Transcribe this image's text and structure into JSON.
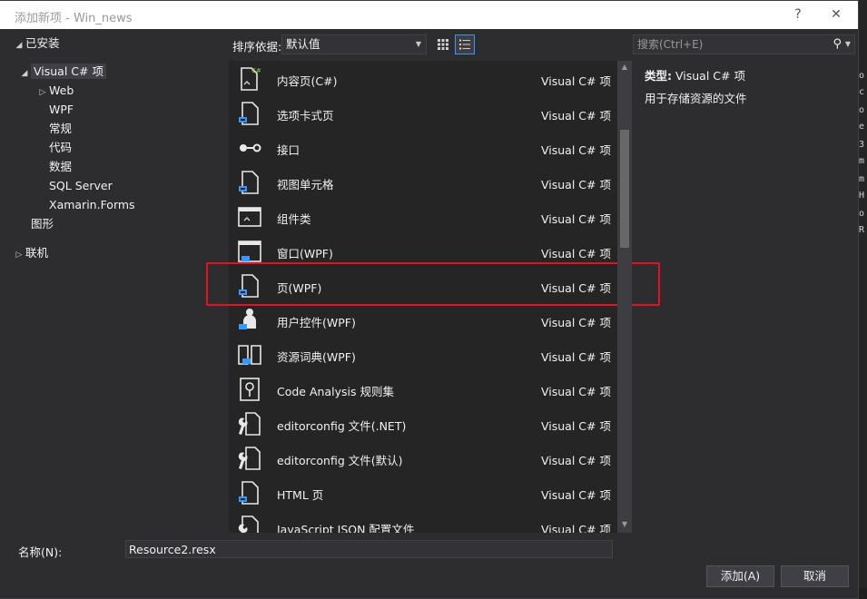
{
  "window": {
    "title": "添加新项 - Win_news",
    "help": "?",
    "close": "✕"
  },
  "tree": {
    "installed": "已安装",
    "visual_csharp": "Visual C# 项",
    "children": [
      "Web",
      "WPF",
      "常规",
      "代码",
      "数据",
      "SQL Server",
      "Xamarin.Forms"
    ],
    "graphics": "图形",
    "online": "联机"
  },
  "toolbar": {
    "sort_label": "排序依据:",
    "sort_value": "默认值"
  },
  "search": {
    "placeholder": "搜索(Ctrl+E)"
  },
  "items": [
    {
      "name": "内容页(C#)",
      "kind": "Visual C# 项",
      "icon": "content-page-icon"
    },
    {
      "name": "选项卡式页",
      "kind": "Visual C# 项",
      "icon": "tabbed-page-icon"
    },
    {
      "name": "接口",
      "kind": "Visual C# 项",
      "icon": "interface-icon"
    },
    {
      "name": "视图单元格",
      "kind": "Visual C# 项",
      "icon": "view-cell-icon"
    },
    {
      "name": "组件类",
      "kind": "Visual C# 项",
      "icon": "component-class-icon"
    },
    {
      "name": "窗口(WPF)",
      "kind": "Visual C# 项",
      "icon": "window-icon"
    },
    {
      "name": "页(WPF)",
      "kind": "Visual C# 项",
      "icon": "page-icon"
    },
    {
      "name": "用户控件(WPF)",
      "kind": "Visual C# 项",
      "icon": "user-control-icon"
    },
    {
      "name": "资源词典(WPF)",
      "kind": "Visual C# 项",
      "icon": "resource-dictionary-icon"
    },
    {
      "name": "Code Analysis 规则集",
      "kind": "Visual C# 项",
      "icon": "rule-set-icon"
    },
    {
      "name": "editorconfig 文件(.NET)",
      "kind": "Visual C# 项",
      "icon": "editorconfig-icon"
    },
    {
      "name": "editorconfig 文件(默认)",
      "kind": "Visual C# 项",
      "icon": "editorconfig-icon"
    },
    {
      "name": "HTML 页",
      "kind": "Visual C# 项",
      "icon": "html-page-icon"
    },
    {
      "name": "JavaScript JSON 配置文件",
      "kind": "Visual C# 项",
      "icon": "json-config-icon"
    }
  ],
  "description": {
    "type_label": "类型:",
    "type_value": "Visual C# 项",
    "text": "用于存储资源的文件"
  },
  "footer": {
    "name_label": "名称(N):",
    "name_value": "Resource2.resx",
    "add": "添加(A)",
    "cancel": "取消"
  },
  "colors": {
    "highlight": "#e81123",
    "accent": "#3399ff",
    "background": "#2d2d30"
  }
}
